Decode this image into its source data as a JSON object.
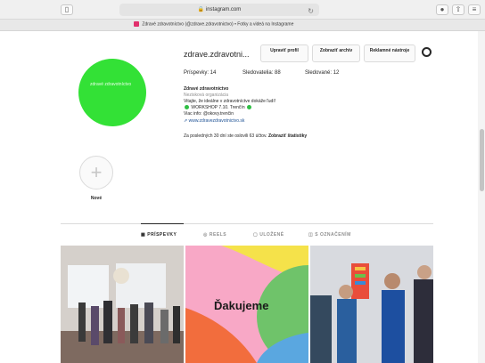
{
  "browser": {
    "url": "instagram.com",
    "tab_title": "Zdravé zdravotníctvo (@zdrave.zdravotnictvo) • Fotky a videá na Instagrame",
    "sidebar_icon": "sidebar-icon",
    "reload_icon": "reload-icon"
  },
  "profile": {
    "username": "zdrave.zdravotni...",
    "avatar_text": "zdravé zdravotníctvo",
    "buttons": {
      "edit": "Upraviť profil",
      "archive": "Zobraziť archív",
      "ads": "Reklamné nástroje"
    },
    "stats": {
      "posts": "Príspevky: 14",
      "followers": "Sledovatelia: 88",
      "following": "Sledované: 12"
    },
    "bio": {
      "name": "Zdravé zdravotníctvo",
      "category": "Nezisková organizácia",
      "line1": "Vitajte, že ideálne v zdravotníctve dokáže ľudí!",
      "line2": "WORKSHOP 7.10. Trenčín",
      "line3": "Viac info: @okovy.trenčin",
      "link": "www.zdravezdravotnictvo.sk",
      "insights": "Za posledných 30 dní ste oslovili 63 účtov.",
      "insights_link": "Zobraziť štatistiky"
    }
  },
  "highlight": {
    "label": "Nové"
  },
  "tabs": [
    {
      "label": "PRÍSPEVKY",
      "icon": "grid-icon"
    },
    {
      "label": "REELS",
      "icon": "reels-icon"
    },
    {
      "label": "ULOŽENÉ",
      "icon": "bookmark-icon"
    },
    {
      "label": "S OZNAČENÍM",
      "icon": "tag-icon"
    }
  ],
  "posts": {
    "thank_you": "Ďakujeme"
  },
  "colors": {
    "avatar_green": "#33e136",
    "link_blue": "#1b4f93",
    "instagram_pink": "#e1306c"
  }
}
